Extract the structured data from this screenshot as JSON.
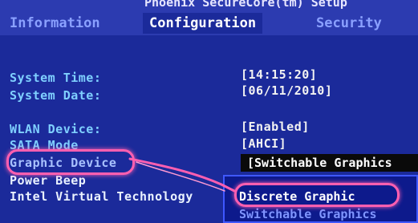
{
  "header": {
    "title": "Phoenix SecureCore(tm) Setup"
  },
  "tabs": [
    {
      "label": "Information"
    },
    {
      "label": "Configuration"
    },
    {
      "label": "Security"
    }
  ],
  "settings": {
    "system_time": {
      "label": "System Time:",
      "value": "[14:15:20]"
    },
    "system_date": {
      "label": "System Date:",
      "value": "[06/11/2010]"
    },
    "wlan_device": {
      "label": "WLAN Device:",
      "value": "[Enabled]"
    },
    "sata_mode": {
      "label": "SATA Mode",
      "value": "[AHCI]"
    },
    "graphic_device": {
      "label": "Graphic Device",
      "value": "[Switchable Graphics"
    },
    "power_beep": {
      "label": "Power Beep"
    },
    "intel_virtual": {
      "label": "Intel Virtual Technology"
    }
  },
  "popup": {
    "options": [
      "Discrete Graphic",
      "Switchable Graphics"
    ],
    "selected": "Discrete Graphic"
  },
  "colors": {
    "background": "#1b2a9a",
    "highlight_marker": "#ff5fb0"
  }
}
